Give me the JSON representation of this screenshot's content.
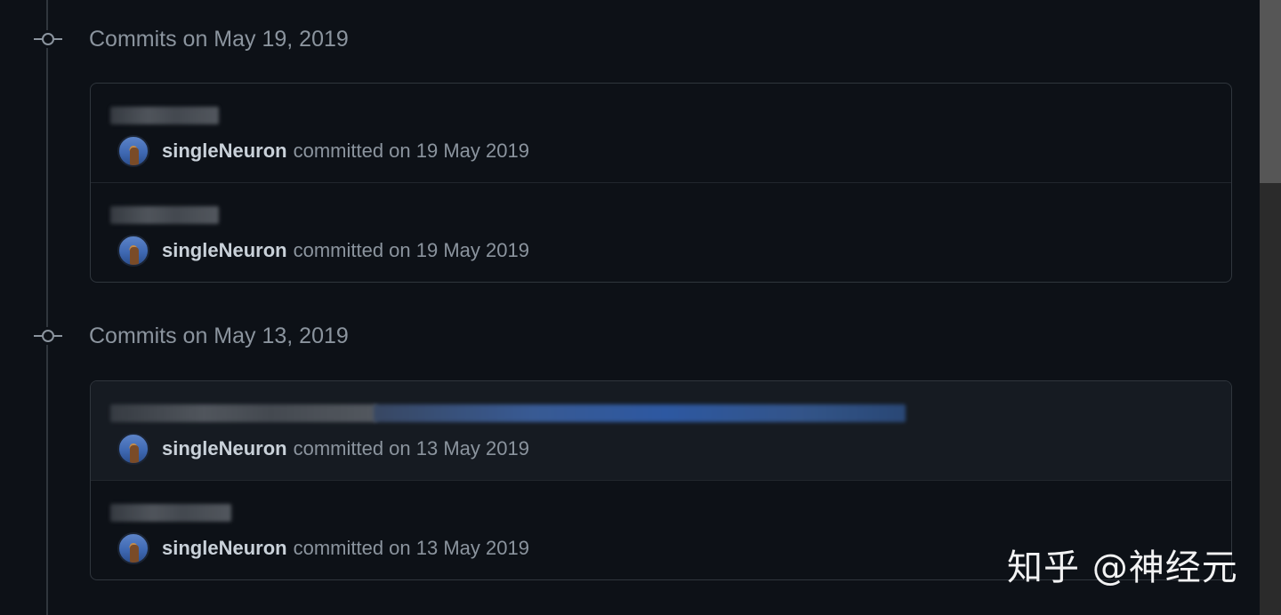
{
  "groups": [
    {
      "title": "Commits on May 19, 2019",
      "commits": [
        {
          "author": "singleNeuron",
          "committed": "committed on 19 May 2019"
        },
        {
          "author": "singleNeuron",
          "committed": "committed on 19 May 2019"
        }
      ]
    },
    {
      "title": "Commits on May 13, 2019",
      "commits": [
        {
          "author": "singleNeuron",
          "committed": "committed on 13 May 2019"
        },
        {
          "author": "singleNeuron",
          "committed": "committed on 13 May 2019"
        }
      ]
    }
  ],
  "watermark": "知乎 @神经元",
  "icons": {
    "group": "git-commit-icon",
    "avatar": "user-avatar"
  },
  "colors": {
    "background": "#0d1117",
    "border": "#30363d",
    "muted_text": "#8b949e",
    "author_text": "#c9d1d9",
    "link_blue": "#2f5ca8"
  }
}
